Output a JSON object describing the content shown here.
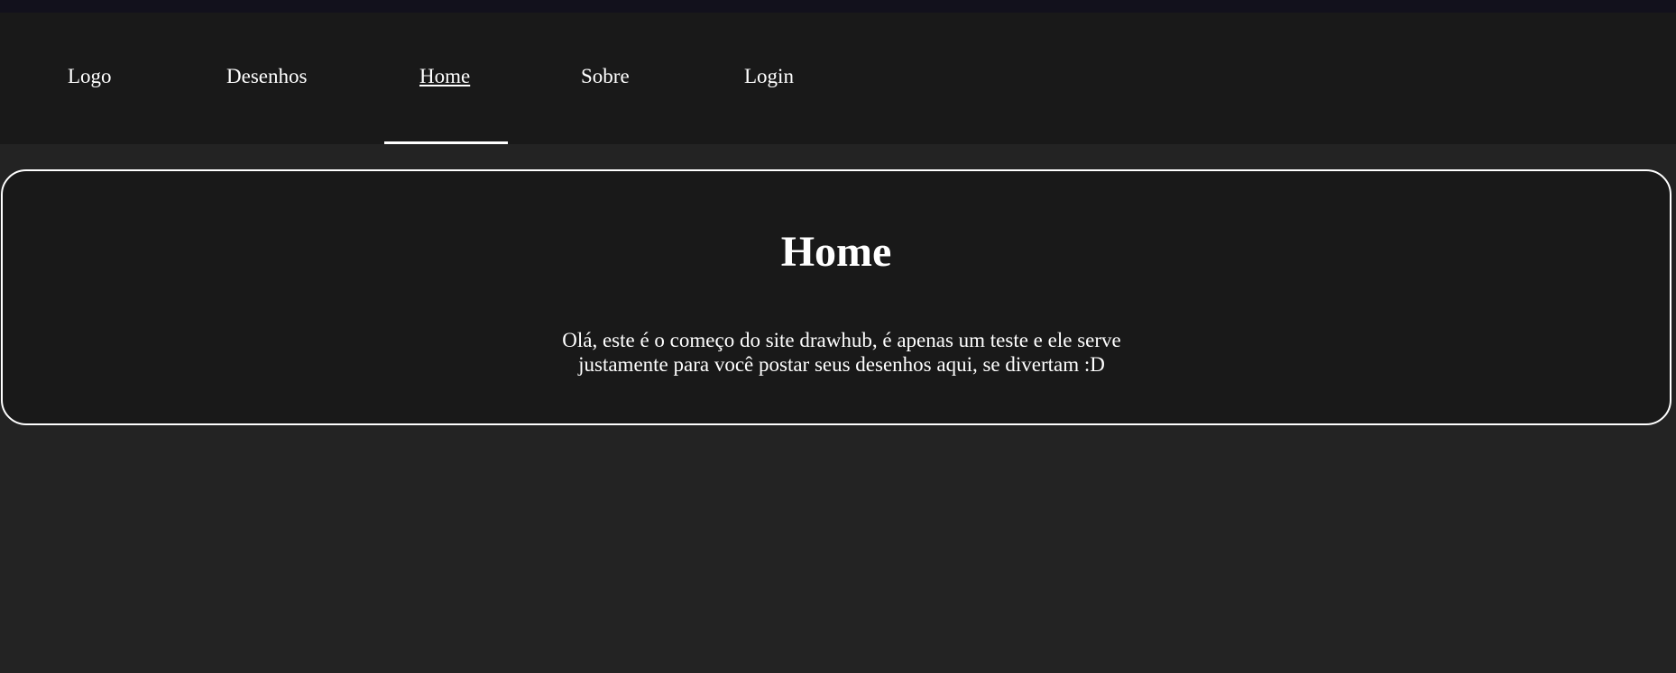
{
  "nav": {
    "items": [
      {
        "label": "Logo"
      },
      {
        "label": "Desenhos"
      },
      {
        "label": "Home",
        "active": true
      },
      {
        "label": "Sobre"
      },
      {
        "label": "Login"
      }
    ]
  },
  "main": {
    "title": "Home",
    "text": "Olá, este é o começo do site drawhub, é apenas um teste e ele serve justamente para você postar seus desenhos aqui, se divertam :D"
  },
  "colors": {
    "background": "#232323",
    "navbar": "#191919",
    "top_strip": "#12111c",
    "card": "#191919",
    "text": "#ffffff",
    "accent": "#ffffff"
  }
}
